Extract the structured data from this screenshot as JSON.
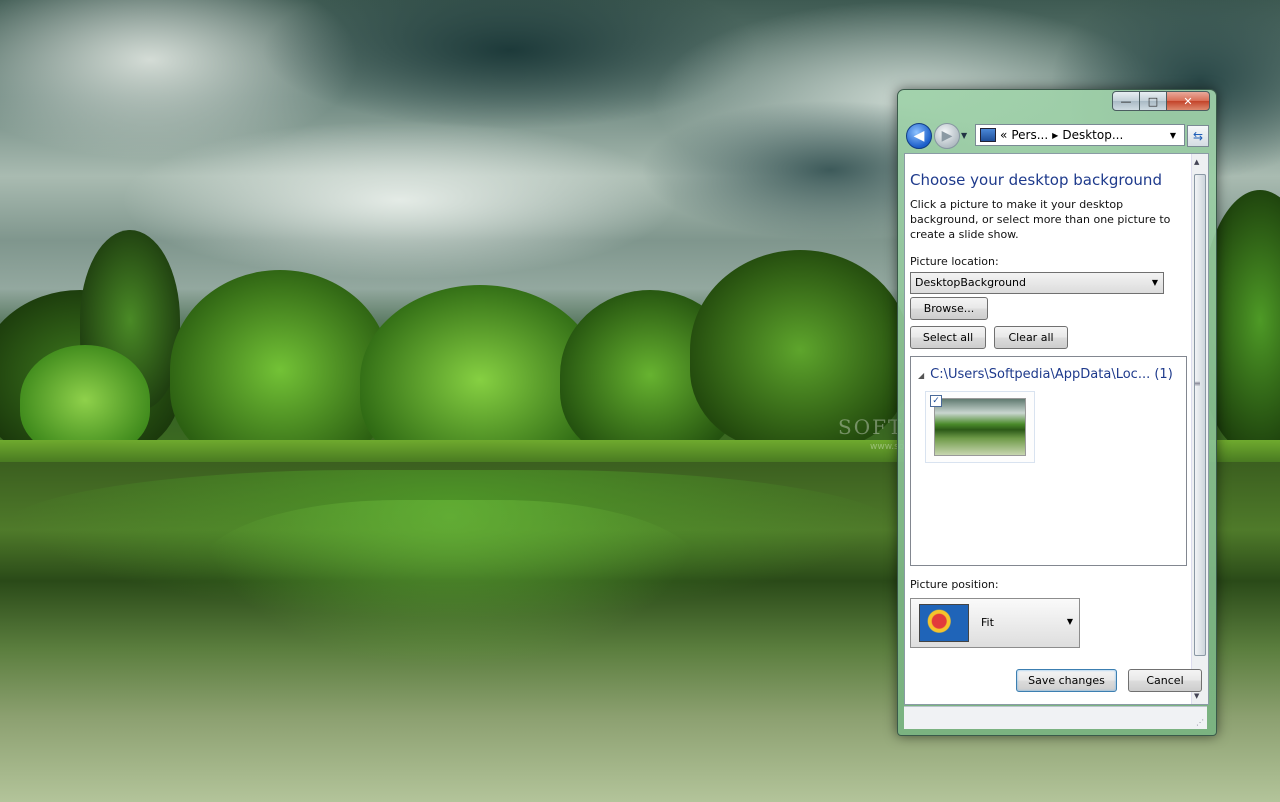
{
  "wallpaper": {
    "watermark": "SOFTPEDIA",
    "watermark_sub": "www.softpedia.com"
  },
  "window": {
    "caption_buttons": {
      "minimize": "—",
      "maximize": "□",
      "close": "✕"
    },
    "address": {
      "part1": "Pers...",
      "part2": "Desktop...",
      "prefix": "«"
    },
    "heading": "Choose your desktop background",
    "description": "Click a picture to make it your desktop background, or select more than one picture to create a slide show.",
    "picture_location_label": "Picture location:",
    "picture_location_value": "DesktopBackground",
    "browse_label": "Browse...",
    "select_all_label": "Select all",
    "clear_all_label": "Clear all",
    "group_header": "C:\\Users\\Softpedia\\AppData\\Loc... (1)",
    "picture_position_label": "Picture position:",
    "picture_position_value": "Fit",
    "save_label": "Save changes",
    "cancel_label": "Cancel"
  },
  "colors": {
    "heading": "#1e3a8c",
    "window_frame": "#8ccc98"
  }
}
